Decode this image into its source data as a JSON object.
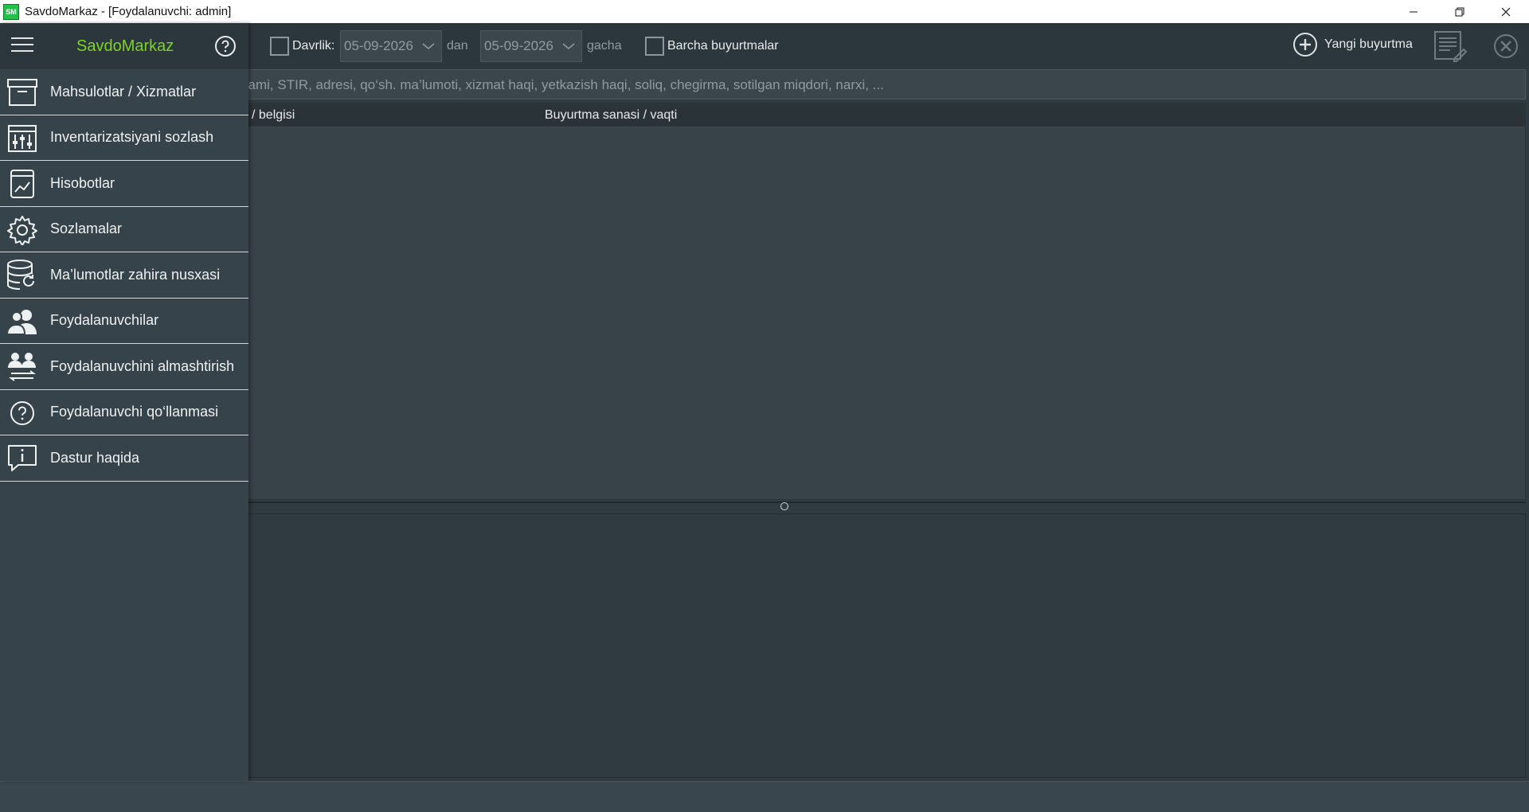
{
  "window": {
    "app_icon": "SM",
    "title": "SavdoMarkaz - [Foydalanuvchi: admin]"
  },
  "toolbar": {
    "period_label": "Davrlik:",
    "date_from": "05-09-2026",
    "from_suffix": "dan",
    "date_to": "05-09-2026",
    "to_suffix": "gacha",
    "all_orders_label": "Barcha buyurtmalar",
    "new_order_label": "Yangi buyurtma"
  },
  "search": {
    "placeholder": "i, to‘lov holati, mijoz ismi, e-maili, tel.raqami, STIR, adresi, qo‘sh. ma’lumoti, xizmat haqi, yetkazish haqi, soliq, chegirma, sotilgan miqdori, narxi, ..."
  },
  "table": {
    "columns": [
      " / belgisi",
      "Buyurtma sanasi / vaqti"
    ]
  },
  "sidebar": {
    "brand": "SavdoMarkaz",
    "items": [
      {
        "label": "Mahsulotlar / Xizmatlar",
        "icon": "archive-box-icon"
      },
      {
        "label": "Inventarizatsiyani sozlash",
        "icon": "sliders-icon"
      },
      {
        "label": "Hisobotlar",
        "icon": "report-chart-icon"
      },
      {
        "label": "Sozlamalar",
        "icon": "gear-icon"
      },
      {
        "label": "Ma’lumotlar zahira nusxasi",
        "icon": "database-backup-icon"
      },
      {
        "label": "Foydalanuvchilar",
        "icon": "users-icon"
      },
      {
        "label": "Foydalanuvchini almashtirish",
        "icon": "switch-user-icon"
      },
      {
        "label": "Foydalanuvchi qo‘llanmasi",
        "icon": "help-circle-icon"
      },
      {
        "label": "Dastur haqida",
        "icon": "info-bubble-icon"
      }
    ]
  },
  "colors": {
    "brand": "#7ed321",
    "background": "#2f3a41",
    "sidebar": "#36434a"
  }
}
